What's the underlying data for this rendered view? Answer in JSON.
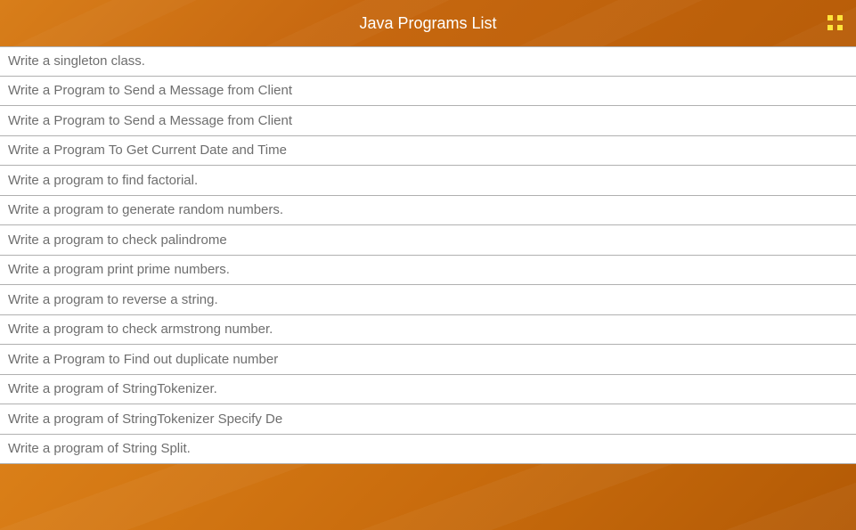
{
  "header": {
    "title": "Java Programs List"
  },
  "list": {
    "items": [
      "Write a singleton class.",
      "Write a Program to Send a Message from Client",
      "Write a Program to Send a Message from Client",
      "Write a Program To Get Current Date and Time",
      "Write a program to find factorial.",
      "Write a program to generate random numbers.",
      "Write a program to check palindrome",
      "Write a program print prime numbers.",
      "Write a program to reverse a string.",
      "Write a program to check armstrong number.",
      "Write a Program to Find out duplicate number",
      "Write a program of StringTokenizer.",
      "Write a program of StringTokenizer Specify De",
      "Write a program of String Split."
    ]
  }
}
